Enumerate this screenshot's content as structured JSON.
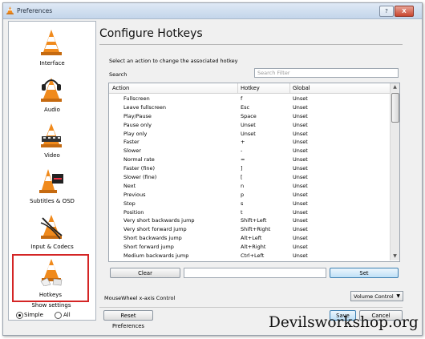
{
  "window": {
    "title": "Preferences",
    "help_label": "?",
    "close_label": "X"
  },
  "sidebar": {
    "categories": [
      {
        "label": "Interface"
      },
      {
        "label": "Audio"
      },
      {
        "label": "Video"
      },
      {
        "label": "Subtitles & OSD"
      },
      {
        "label": "Input & Codecs"
      },
      {
        "label": "Hotkeys",
        "selected": true
      }
    ],
    "show_settings": {
      "label": "Show settings",
      "simple": "Simple",
      "all": "All",
      "selected": "Simple"
    }
  },
  "panel": {
    "title": "Configure Hotkeys",
    "instruction": "Select an action to change the associated hotkey",
    "search_label": "Search",
    "search_placeholder": "Search Filter",
    "columns": [
      "Action",
      "Hotkey",
      "Global"
    ],
    "rows": [
      {
        "action": "Fullscreen",
        "hotkey": "f",
        "global": "Unset"
      },
      {
        "action": "Leave fullscreen",
        "hotkey": "Esc",
        "global": "Unset"
      },
      {
        "action": "Play/Pause",
        "hotkey": "Space",
        "global": "Unset"
      },
      {
        "action": "Pause only",
        "hotkey": "Unset",
        "global": "Unset"
      },
      {
        "action": "Play only",
        "hotkey": "Unset",
        "global": "Unset"
      },
      {
        "action": "Faster",
        "hotkey": "+",
        "global": "Unset"
      },
      {
        "action": "Slower",
        "hotkey": "-",
        "global": "Unset"
      },
      {
        "action": "Normal rate",
        "hotkey": "=",
        "global": "Unset"
      },
      {
        "action": "Faster (fine)",
        "hotkey": "]",
        "global": "Unset"
      },
      {
        "action": "Slower (fine)",
        "hotkey": "[",
        "global": "Unset"
      },
      {
        "action": "Next",
        "hotkey": "n",
        "global": "Unset"
      },
      {
        "action": "Previous",
        "hotkey": "p",
        "global": "Unset"
      },
      {
        "action": "Stop",
        "hotkey": "s",
        "global": "Unset"
      },
      {
        "action": "Position",
        "hotkey": "t",
        "global": "Unset"
      },
      {
        "action": "Very short backwards jump",
        "hotkey": "Shift+Left",
        "global": "Unset"
      },
      {
        "action": "Very short forward jump",
        "hotkey": "Shift+Right",
        "global": "Unset"
      },
      {
        "action": "Short backwards jump",
        "hotkey": "Alt+Left",
        "global": "Unset"
      },
      {
        "action": "Short forward jump",
        "hotkey": "Alt+Right",
        "global": "Unset"
      },
      {
        "action": "Medium backwards jump",
        "hotkey": "Ctrl+Left",
        "global": "Unset"
      }
    ],
    "clear_label": "Clear",
    "set_label": "Set",
    "mousewheel_label": "MouseWheel x-axis Control",
    "mousewheel_value": "Volume Control"
  },
  "footer": {
    "reset_label": "Reset Preferences",
    "save_label": "Save",
    "cancel_label": "Cancel"
  },
  "watermark": "Devilsworkshop.org",
  "colors": {
    "selection_outline": "#d42525",
    "cone_orange": "#f08a1c",
    "accent_blue": "#3c7fb1"
  }
}
